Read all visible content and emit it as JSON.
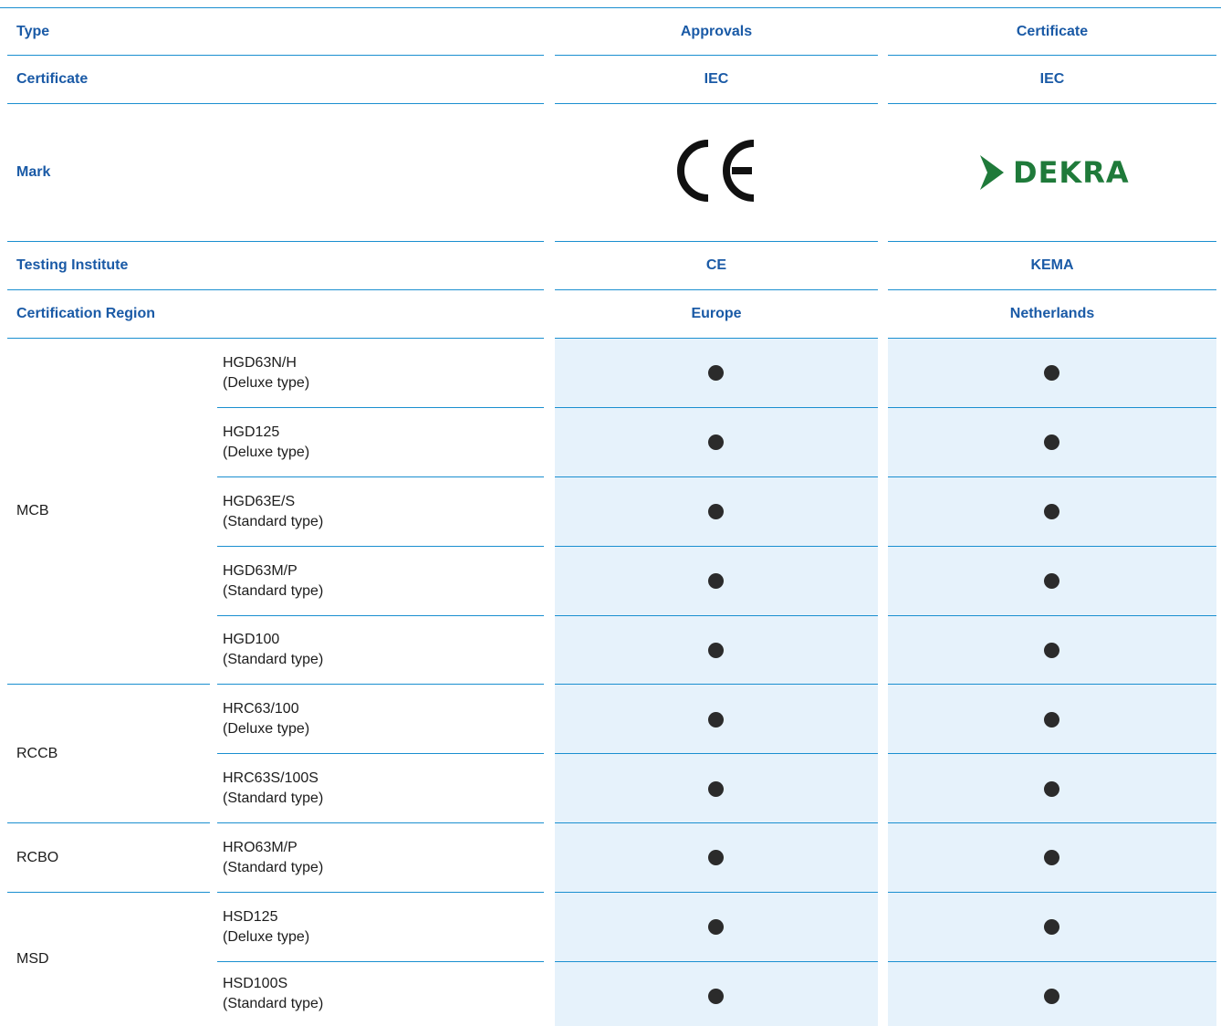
{
  "header": {
    "type": {
      "label": "Type",
      "approvals": "Approvals",
      "certificate": "Certificate"
    },
    "certificate": {
      "label": "Certificate",
      "col1": "IEC",
      "col2": "IEC"
    },
    "mark": {
      "label": "Mark",
      "col1_mark": "CE",
      "col2_mark": "DEKRA"
    },
    "testing_institute": {
      "label": "Testing Institute",
      "col1": "CE",
      "col2": "KEMA"
    },
    "region": {
      "label": "Certification Region",
      "col1": "Europe",
      "col2": "Netherlands"
    }
  },
  "colors": {
    "accent": "#1a5aa6",
    "line": "#1a8fd0",
    "cell_bg": "#e6f2fb",
    "dekra_green": "#1f7a3a"
  },
  "groups": [
    {
      "name": "MCB",
      "products": [
        {
          "model": "HGD63N/H",
          "type": "(Deluxe type)",
          "ce": true,
          "kema": true
        },
        {
          "model": "HGD125",
          "type": "(Deluxe type)",
          "ce": true,
          "kema": true
        },
        {
          "model": "HGD63E/S",
          "type": "(Standard type)",
          "ce": true,
          "kema": true
        },
        {
          "model": "HGD63M/P",
          "type": "(Standard type)",
          "ce": true,
          "kema": true
        },
        {
          "model": "HGD100",
          "type": "(Standard type)",
          "ce": true,
          "kema": true
        }
      ]
    },
    {
      "name": "RCCB",
      "products": [
        {
          "model": "HRC63/100",
          "type": "(Deluxe type)",
          "ce": true,
          "kema": true
        },
        {
          "model": "HRC63S/100S",
          "type": "(Standard type)",
          "ce": true,
          "kema": true
        }
      ]
    },
    {
      "name": "RCBO",
      "products": [
        {
          "model": "HRO63M/P",
          "type": "(Standard type)",
          "ce": true,
          "kema": true
        }
      ]
    },
    {
      "name": "MSD",
      "products": [
        {
          "model": "HSD125",
          "type": "(Deluxe type)",
          "ce": true,
          "kema": true
        },
        {
          "model": "HSD100S",
          "type": "(Standard type)",
          "ce": true,
          "kema": true
        }
      ]
    }
  ]
}
